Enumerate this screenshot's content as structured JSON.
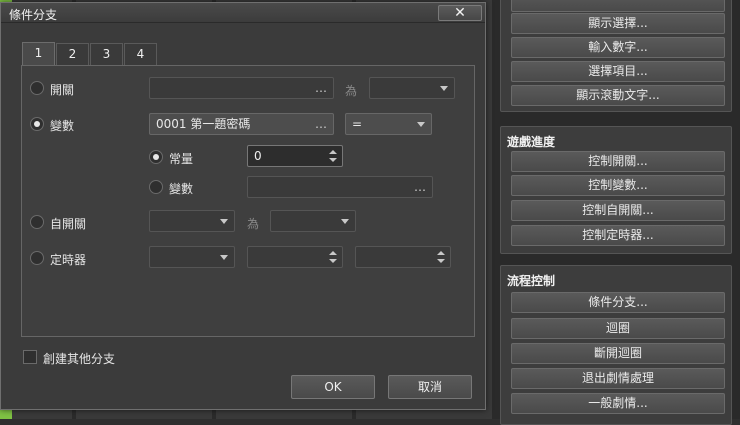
{
  "dialog": {
    "title": "條件分支",
    "close": "✕",
    "tabs": [
      "1",
      "2",
      "3",
      "4"
    ],
    "rows": {
      "switch": {
        "label": "開關",
        "value": "",
        "between": "為"
      },
      "variable": {
        "label": "變數",
        "value": "0001 第一題密碼",
        "operator": "="
      },
      "constant": {
        "label": "常量",
        "value": "0"
      },
      "variable2": {
        "label": "變數",
        "value": ""
      },
      "self_switch": {
        "label": "自開關",
        "between": "為"
      },
      "timer": {
        "label": "定時器"
      }
    },
    "else_label": "創建其他分支",
    "ok": "OK",
    "cancel": "取消",
    "ellipsis": "…"
  },
  "right_panel": {
    "message_buttons": [
      "顯示選擇...",
      "輸入數字...",
      "選擇項目...",
      "顯示滾動文字..."
    ],
    "game_progress": {
      "title": "遊戲進度",
      "buttons": [
        "控制開關...",
        "控制變數...",
        "控制自開關...",
        "控制定時器..."
      ]
    },
    "flow_control": {
      "title": "流程控制",
      "buttons": [
        "條件分支...",
        "迴圈",
        "斷開迴圈",
        "退出劇情處理",
        "一般劇情..."
      ]
    }
  }
}
